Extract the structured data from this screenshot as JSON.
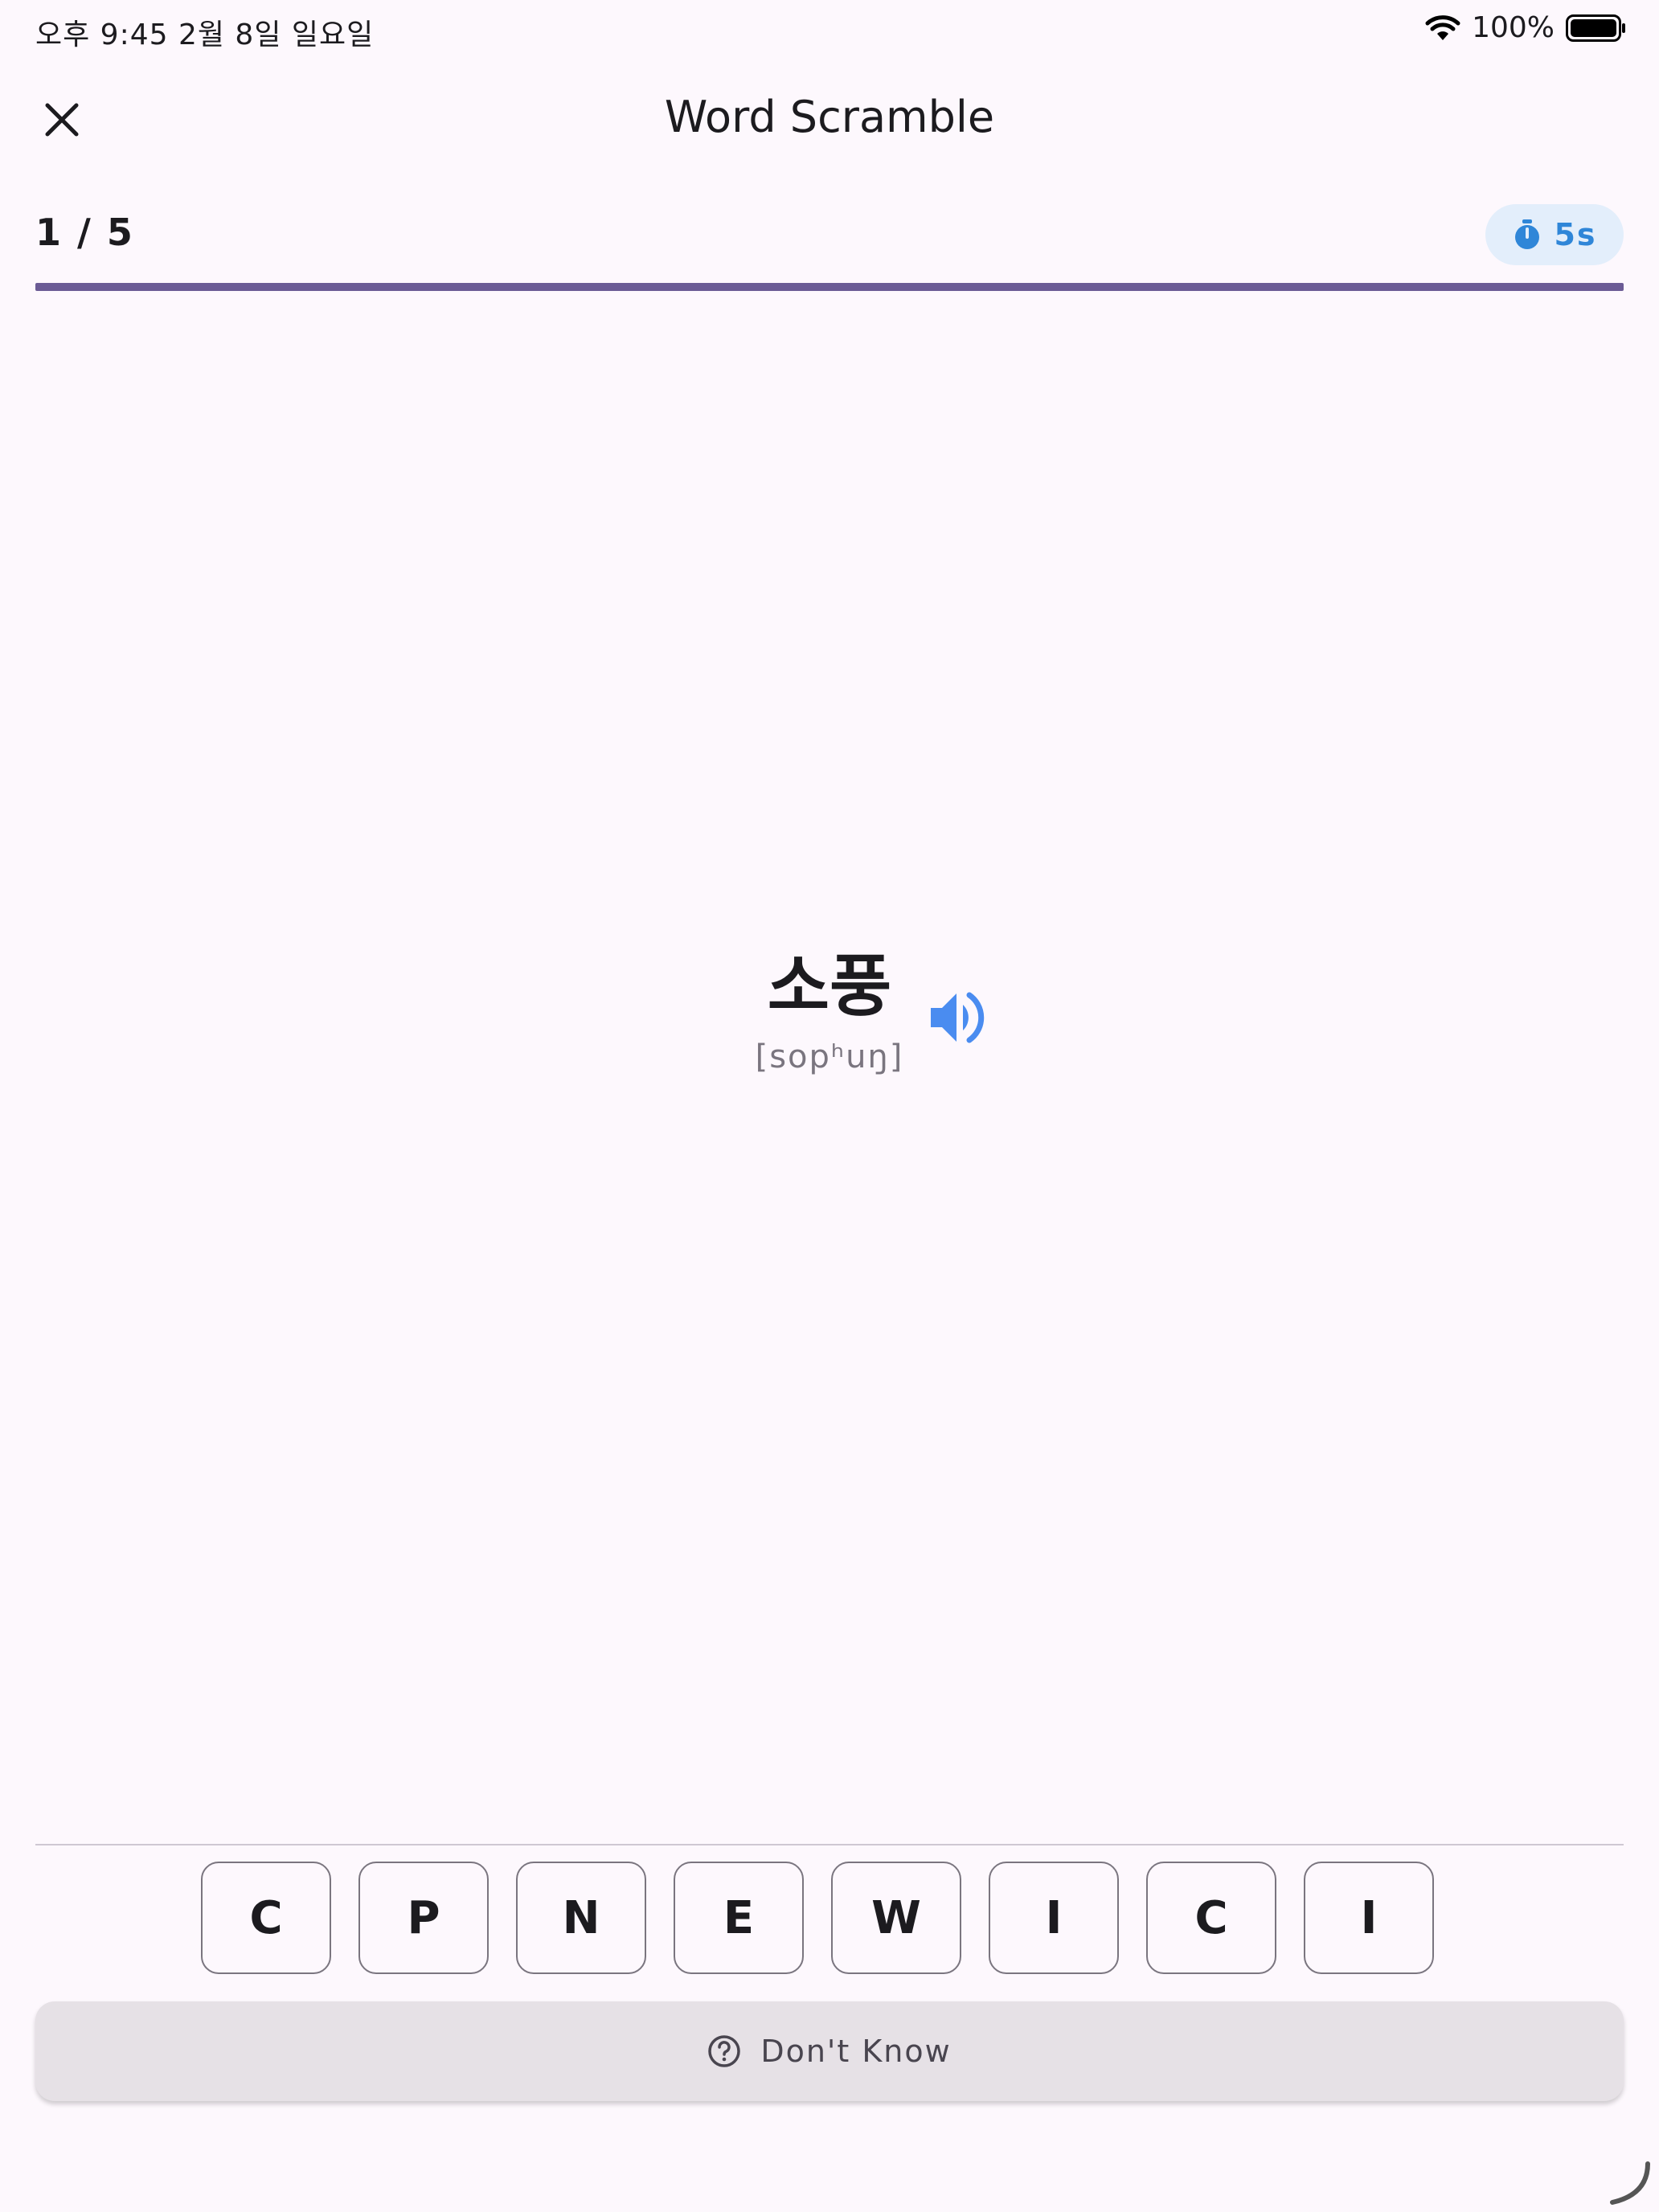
{
  "status_bar": {
    "time": "오후 9:45   2월 8일 일요일",
    "battery": "100%",
    "battery_level": 1.0,
    "wifi_icon": "wifi-icon",
    "battery_icon": "battery-icon"
  },
  "app_bar": {
    "title": "Word Scramble",
    "close_icon": "close-icon"
  },
  "progress": {
    "count": "1 / 5",
    "current": 1,
    "total": 5,
    "fill_fraction": 1.0,
    "timer": "5s",
    "timer_icon": "stopwatch-icon"
  },
  "word": {
    "text": "소풍",
    "phonetic": "[sopʰuŋ]",
    "speaker_icon": "speaker-icon"
  },
  "tiles": [
    "C",
    "P",
    "N",
    "E",
    "W",
    "I",
    "C",
    "I"
  ],
  "dont_know": {
    "label": "Don't Know",
    "icon": "help-circle-icon"
  },
  "colors": {
    "background": "#fdf8fd",
    "progress": "#6b5b95",
    "timer_text": "#2f86d8",
    "timer_bg": "#e3eefb",
    "speaker": "#4a8cf0",
    "button_bg": "#e6e1e6"
  }
}
